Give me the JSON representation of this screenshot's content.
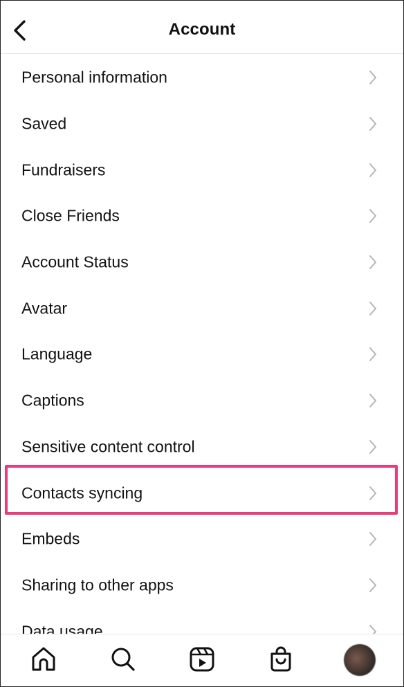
{
  "header": {
    "title": "Account",
    "back_icon": "chevron-left-icon"
  },
  "list": {
    "items": [
      {
        "label": "Personal information"
      },
      {
        "label": "Saved"
      },
      {
        "label": "Fundraisers"
      },
      {
        "label": "Close Friends"
      },
      {
        "label": "Account Status"
      },
      {
        "label": "Avatar"
      },
      {
        "label": "Language"
      },
      {
        "label": "Captions"
      },
      {
        "label": "Sensitive content control"
      },
      {
        "label": "Contacts syncing",
        "highlighted": true
      },
      {
        "label": "Embeds"
      },
      {
        "label": "Sharing to other apps"
      },
      {
        "label": "Data usage"
      }
    ],
    "chevron_icon": "chevron-right-icon"
  },
  "highlight_color": "#ea3a78",
  "tabbar": {
    "tabs": [
      {
        "icon": "home-icon"
      },
      {
        "icon": "search-icon"
      },
      {
        "icon": "reels-icon"
      },
      {
        "icon": "shop-icon"
      },
      {
        "icon": "profile-avatar"
      }
    ]
  }
}
